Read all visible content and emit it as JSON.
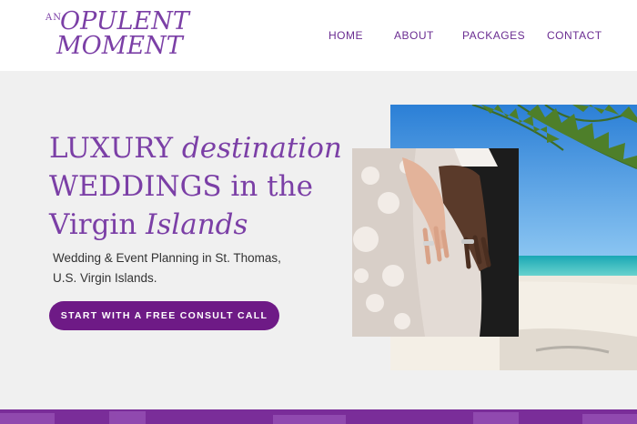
{
  "logo": {
    "prefix": "AN",
    "line1": "OPULENT",
    "line2": "MOMENT"
  },
  "nav": {
    "items": [
      "HOME",
      "ABOUT",
      "PACKAGES",
      "CONTACT"
    ]
  },
  "hero": {
    "headline": {
      "line1_a": "LUXURY ",
      "line1_b": "destination",
      "line2": "WEDDINGS in the",
      "line3_a": "Virgin ",
      "line3_b": "Islands"
    },
    "subtext_line1": "Wedding & Event Planning in St. Thomas,",
    "subtext_line2": "U.S. Virgin Islands.",
    "cta_label": "START WITH A FREE CONSULT CALL"
  },
  "colors": {
    "brand_purple": "#7b3fa6",
    "cta_purple": "#6e1a86",
    "nav_purple": "#6a2c91",
    "background": "#f0f0f0"
  }
}
